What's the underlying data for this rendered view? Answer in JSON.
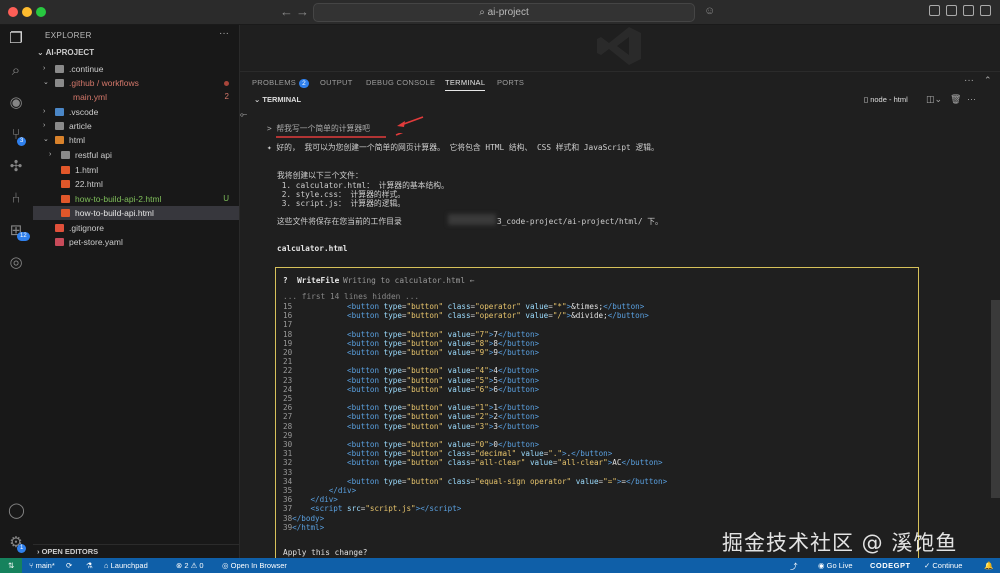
{
  "titlebar": {
    "search_text": "⌕ ai-project"
  },
  "sidebar": {
    "header": "EXPLORER",
    "project": "AI-PROJECT",
    "open_editors": "OPEN EDITORS",
    "items": [
      {
        "label": ".continue",
        "status": ""
      },
      {
        "label": ".github / workflows",
        "status": ""
      },
      {
        "label": "main.yml",
        "status": "2"
      },
      {
        "label": ".vscode",
        "status": ""
      },
      {
        "label": "article",
        "status": ""
      },
      {
        "label": "html",
        "status": ""
      },
      {
        "label": "restful api",
        "status": ""
      },
      {
        "label": "1.html",
        "status": ""
      },
      {
        "label": "22.html",
        "status": ""
      },
      {
        "label": "how-to-build-api-2.html",
        "status": "U"
      },
      {
        "label": "how-to-build-api.html",
        "status": ""
      },
      {
        "label": ".gitignore",
        "status": ""
      },
      {
        "label": "pet-store.yaml",
        "status": ""
      }
    ]
  },
  "activity": {
    "source_control_badge": "3",
    "extensions_badge": "12",
    "settings_badge": "1"
  },
  "panel": {
    "tabs": [
      "PROBLEMS",
      "OUTPUT",
      "DEBUG CONSOLE",
      "TERMINAL",
      "PORTS"
    ],
    "problems_count": "2",
    "terminal_label": "TERMINAL",
    "shell_label": "node - html"
  },
  "terminal": {
    "prompt": "> 帮我写一个简单的计算器吧",
    "reply": "✦ 好的， 我可以为您创建一个简单的网页计算器。 它将包含 HTML 结构、 CSS 样式和 JavaScript 逻辑。",
    "plan_title": "我将创建以下三个文件：",
    "plan_items": [
      " 1. calculator.html： 计算器的基本结构。",
      " 2. style.css： 计算器的样式。",
      " 3. script.js： 计算器的逻辑。"
    ],
    "save_prefix": "这些文件将保存在您当前的工作目录",
    "save_path": "3_code-project/ai-project/html/ 下。",
    "file_title": "calculator.html",
    "dialog_title": "?  WriteFile",
    "dialog_sub": "Writing to calculator.html ←",
    "hidden_note": "... first 14 lines hidden ...",
    "apply": "Apply this change?"
  },
  "statusbar": {
    "branch": "main*",
    "launchpad": "Launchpad",
    "problems": "⊗ 2 ⚠ 0",
    "open_browser": "Open In Browser",
    "go_live": "Go Live",
    "codegpt": "CODEGPT",
    "continue": "Continue"
  },
  "watermark": "掘金技术社区 @ 溪饱鱼",
  "colors": {
    "accent": "#0f5fa8",
    "dialog_border": "#d6c15a",
    "badge": "#2f80ed"
  }
}
